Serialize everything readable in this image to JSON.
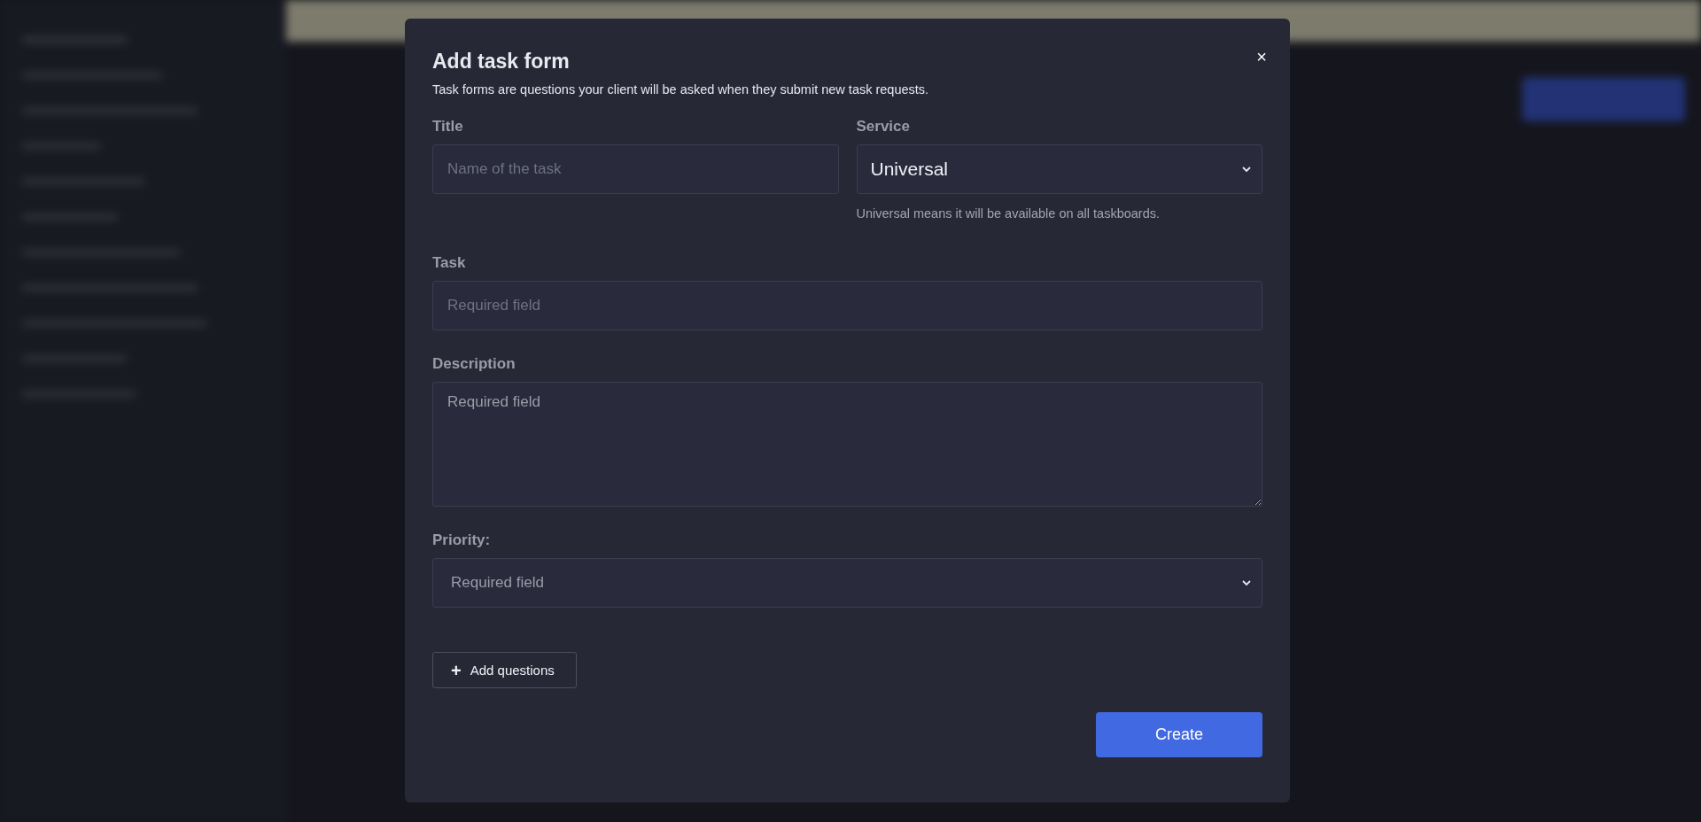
{
  "dialog": {
    "title": "Add task form",
    "subtitle": "Task forms are questions your client will be asked when they submit new task requests.",
    "close": "×",
    "rows": [
      {
        "fields": [
          {
            "kind": "input",
            "label": "Title",
            "placeholder": "Name of the task"
          },
          {
            "kind": "select",
            "label": "Service",
            "value": "Universal",
            "hint": "Universal means it will be available on all taskboards."
          }
        ]
      },
      {
        "fields": [
          {
            "kind": "input",
            "label": "Task",
            "placeholder": "Required field"
          }
        ]
      },
      {
        "fields": [
          {
            "kind": "textarea",
            "label": "Description",
            "placeholder": "Required field"
          }
        ]
      },
      {
        "fields": [
          {
            "kind": "select",
            "label": "Priority:",
            "placeholder": "Required field"
          }
        ]
      }
    ],
    "add_button": {
      "icon": "+",
      "label": "Add questions"
    },
    "submit_button": {
      "label": "Create"
    }
  }
}
